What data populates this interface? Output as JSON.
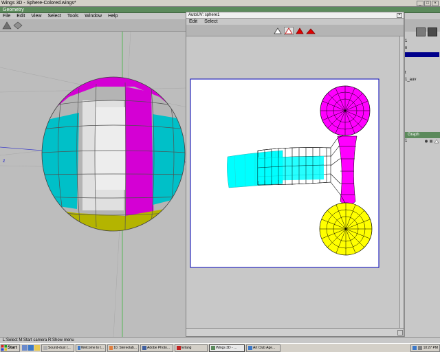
{
  "window": {
    "title": "Wings 3D - Sphere-Colored.wings*",
    "minimize": "_",
    "maximize": "□",
    "close": "×"
  },
  "geometry_header": "Geometry",
  "menu": [
    "File",
    "Edit",
    "View",
    "Select",
    "Tools",
    "Window",
    "Help"
  ],
  "viewport": {
    "axis_label": "z"
  },
  "autouv": {
    "title": "AutoUV: sphere1",
    "close": "×",
    "menu": [
      "Edit",
      "Select"
    ]
  },
  "outliner": {
    "rows": [
      "1",
      "n",
      "t",
      "1_auv"
    ]
  },
  "graph": {
    "header": "Graph",
    "row": "1"
  },
  "status": "L:Select  M:Start camera  R:Show menu",
  "taskbar": {
    "start": "Start",
    "tasks": [
      "Sound-dust (...",
      "Welcome to t...",
      "10. Stereolab...",
      "Adobe Photo...",
      "Erlang",
      "Wings 3D - ...",
      "Art Club Age..."
    ],
    "active_task": 5,
    "clock": "10:27 PM"
  },
  "colors": {
    "sphere_magenta": "#d400d4",
    "sphere_cyan": "#00c0c8",
    "sphere_olive": "#b4b400",
    "uv_magenta": "#ff00ff",
    "uv_cyan": "#00ffff",
    "uv_yellow": "#ffff00",
    "header_green": "#5c8a5c",
    "selection_blue": "#00008b"
  }
}
